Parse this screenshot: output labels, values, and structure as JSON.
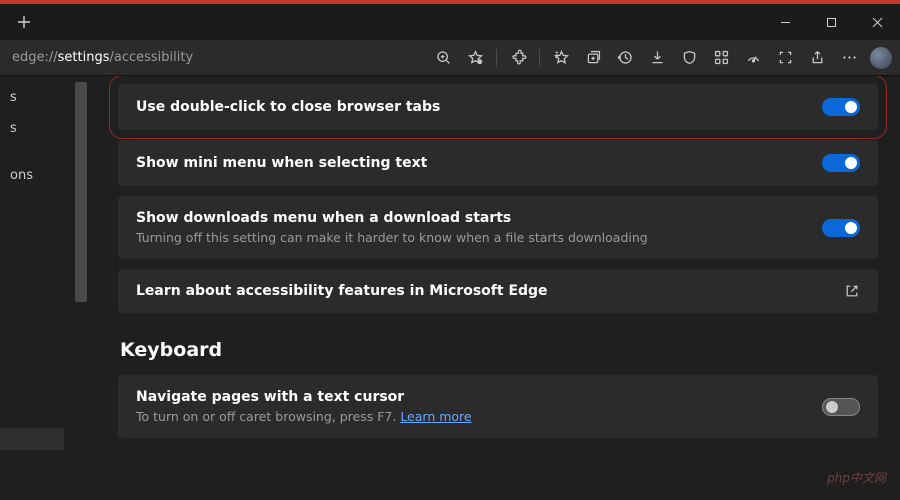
{
  "url": {
    "pre": "edge://",
    "mid": "settings",
    "post": "/accessibility"
  },
  "sidebar": {
    "items": [
      "s",
      "s",
      "",
      "ons"
    ]
  },
  "cards": {
    "dblclick": {
      "title": "Use double-click to close browser tabs"
    },
    "minimenu": {
      "title": "Show mini menu when selecting text"
    },
    "downloads": {
      "title": "Show downloads menu when a download starts",
      "sub": "Turning off this setting can make it harder to know when a file starts downloading"
    },
    "learn": {
      "title": "Learn about accessibility features in Microsoft Edge"
    }
  },
  "section": {
    "keyboard": "Keyboard"
  },
  "caret": {
    "title": "Navigate pages with a text cursor",
    "sub_pre": "To turn on or off caret browsing, press F7. ",
    "link": "Learn more"
  },
  "watermark": "php中文网"
}
